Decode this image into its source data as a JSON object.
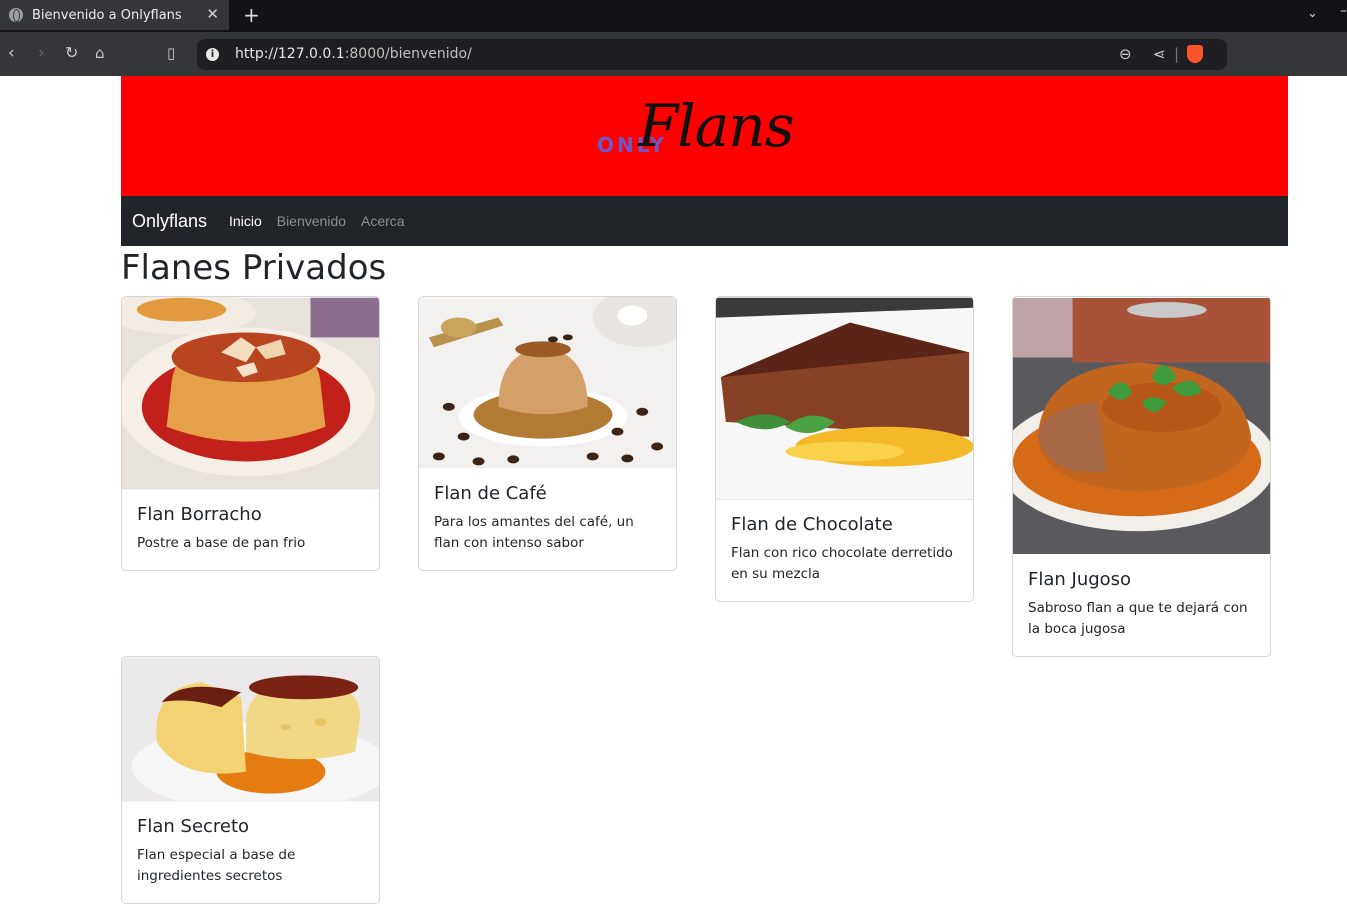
{
  "browser": {
    "tab_title": "Bienvenido a Onlyflans",
    "url_host": "http://127.0.0.1",
    "url_rest": ":8000/bienvenido/"
  },
  "site": {
    "logo_only": "ONLY",
    "logo_flans": "Flans",
    "brand": "Onlyflans",
    "nav": [
      "Inicio",
      "Bienvenido",
      "Acerca"
    ],
    "page_title": "Flanes Privados",
    "colors": {
      "banner": "#ff0000",
      "navbar": "#212529",
      "logo_only": "#6f57c9"
    }
  },
  "cards": [
    {
      "title": "Flan Borracho",
      "desc": "Postre a base de pan frio"
    },
    {
      "title": "Flan de Café",
      "desc": "Para los amantes del café, un flan con intenso sabor"
    },
    {
      "title": "Flan de Chocolate",
      "desc": "Flan con rico chocolate derretido en su mezcla"
    },
    {
      "title": "Flan Jugoso",
      "desc": "Sabroso flan a que te dejará con la boca jugosa"
    },
    {
      "title": "Flan Secreto",
      "desc": "Flan especial a base de ingredientes secretos"
    }
  ]
}
